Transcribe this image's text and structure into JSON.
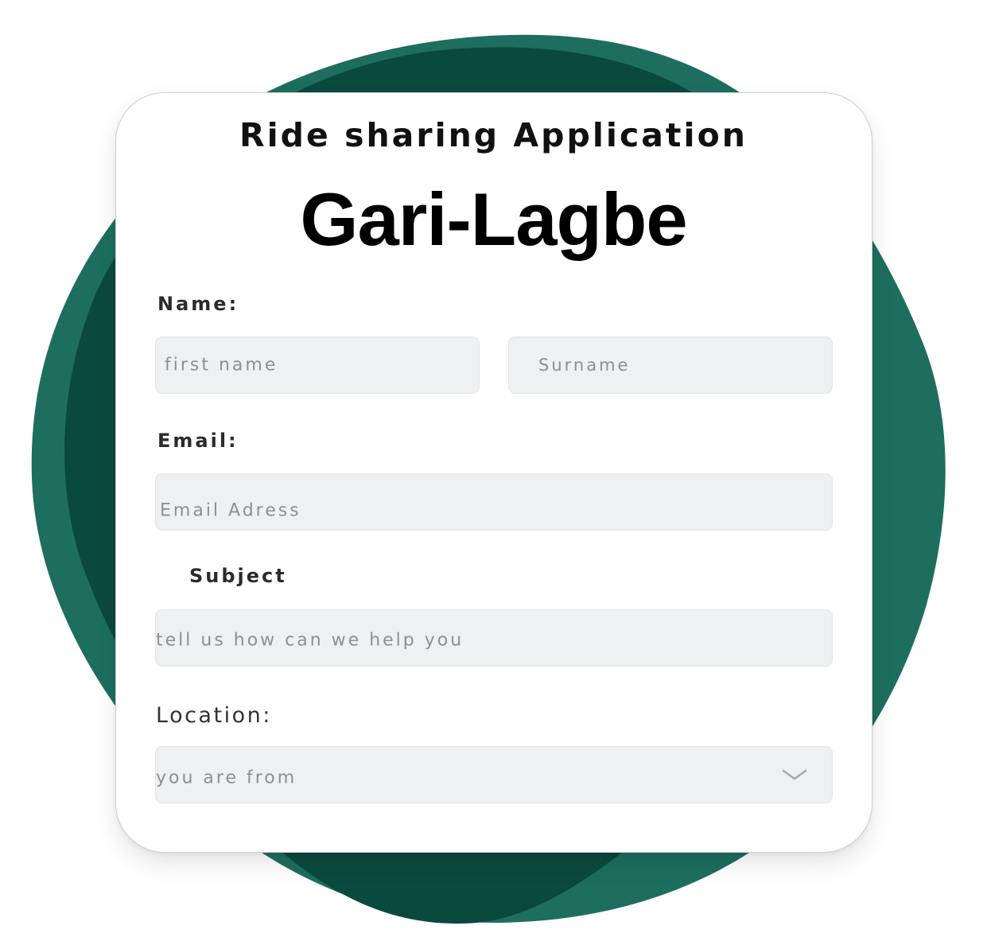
{
  "colors": {
    "blob_light": "#1d6e5f",
    "blob_dark": "#0a493e",
    "field_bg": "#eff0f1",
    "placeholder": "#8d8f92"
  },
  "header": {
    "subtitle": "Ride sharing Application",
    "brand": "Gari-Lagbe"
  },
  "form": {
    "name_label": "Name:",
    "first_name_placeholder": "first name",
    "surname_placeholder": "Surname",
    "email_label": "Email:",
    "email_placeholder": "Email Adress",
    "subject_label": "Subject",
    "subject_placeholder": "tell us how can we help you",
    "location_label": "Location:",
    "location_placeholder": "you are from",
    "location_icon": "chevron-down-icon"
  }
}
